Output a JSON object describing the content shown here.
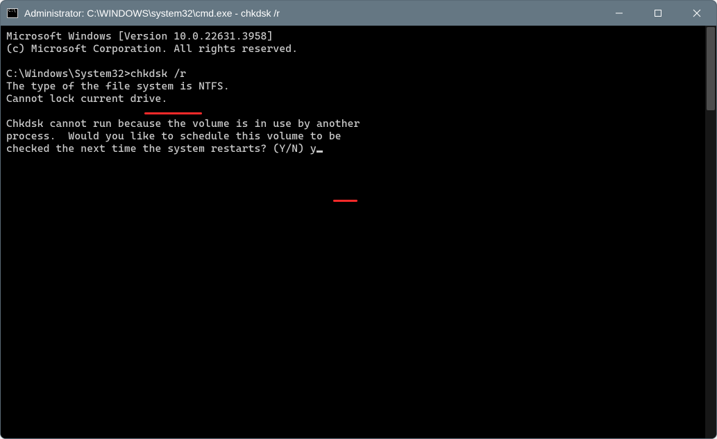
{
  "window": {
    "title": "Administrator: C:\\WINDOWS\\system32\\cmd.exe - chkdsk  /r"
  },
  "terminal": {
    "line_version": "Microsoft Windows [Version 10.0.22631.3958]",
    "line_copyright": "(c) Microsoft Corporation. All rights reserved.",
    "prompt_path": "C:\\Windows\\System32>",
    "typed_command": "chkdsk /r",
    "line_fs": "The type of the file system is NTFS.",
    "line_lock": "Cannot lock current drive.",
    "line_msg1": "Chkdsk cannot run because the volume is in use by another",
    "line_msg2": "process.  Would you like to schedule this volume to be",
    "line_msg3": "checked the next time the system restarts? (Y/N) ",
    "typed_answer": "y"
  }
}
